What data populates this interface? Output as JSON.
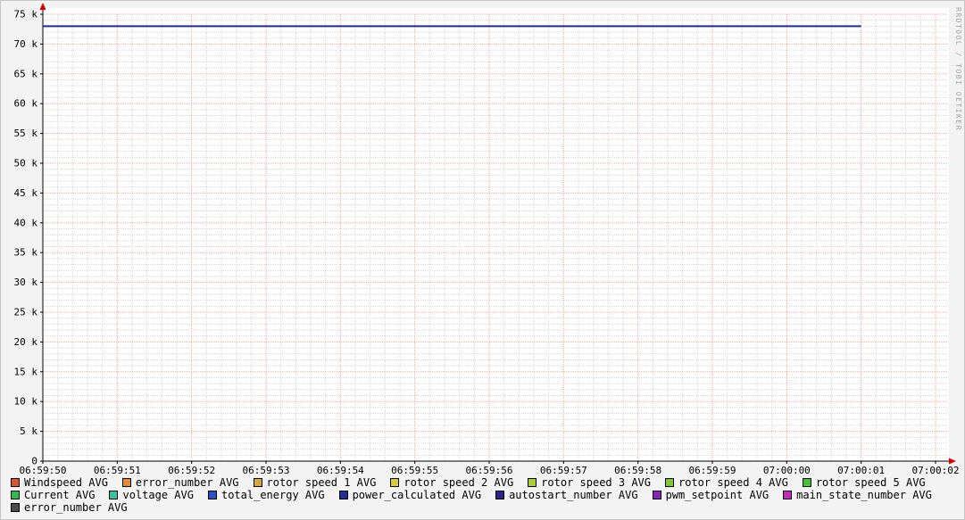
{
  "watermark": "RRDTOOL / TOBI OETIKER",
  "chart_data": {
    "type": "line",
    "title": "",
    "xlim": [
      0,
      12
    ],
    "ylim": [
      0,
      75000
    ],
    "x_major_step": 1,
    "x_minor_step": 0.2,
    "y_major_step": 5000,
    "y_minor_step": 1000,
    "x_ticks": [
      {
        "x": 0,
        "label": "06:59:50"
      },
      {
        "x": 1,
        "label": "06:59:51"
      },
      {
        "x": 2,
        "label": "06:59:52"
      },
      {
        "x": 3,
        "label": "06:59:53"
      },
      {
        "x": 4,
        "label": "06:59:54"
      },
      {
        "x": 5,
        "label": "06:59:55"
      },
      {
        "x": 6,
        "label": "06:59:56"
      },
      {
        "x": 7,
        "label": "06:59:57"
      },
      {
        "x": 8,
        "label": "06:59:58"
      },
      {
        "x": 9,
        "label": "06:59:59"
      },
      {
        "x": 10,
        "label": "07:00:00"
      },
      {
        "x": 11,
        "label": "07:00:01"
      },
      {
        "x": 12,
        "label": "07:00:02"
      }
    ],
    "y_ticks": [
      {
        "value": 0,
        "label": "0"
      },
      {
        "value": 5000,
        "label": "5 k"
      },
      {
        "value": 10000,
        "label": "10 k"
      },
      {
        "value": 15000,
        "label": "15 k"
      },
      {
        "value": 20000,
        "label": "20 k"
      },
      {
        "value": 25000,
        "label": "25 k"
      },
      {
        "value": 30000,
        "label": "30 k"
      },
      {
        "value": 35000,
        "label": "35 k"
      },
      {
        "value": 40000,
        "label": "40 k"
      },
      {
        "value": 45000,
        "label": "45 k"
      },
      {
        "value": 50000,
        "label": "50 k"
      },
      {
        "value": 55000,
        "label": "55 k"
      },
      {
        "value": 60000,
        "label": "60 k"
      },
      {
        "value": 65000,
        "label": "65 k"
      },
      {
        "value": 70000,
        "label": "70 k"
      },
      {
        "value": 75000,
        "label": "75 k"
      }
    ],
    "series": [
      {
        "name": "power_calculated AVG",
        "color": "#1b2e9b",
        "points": [
          [
            0,
            73000
          ],
          [
            11,
            73000
          ]
        ]
      }
    ],
    "grid": {
      "background": "#ffffff",
      "major_color": "#f2aba4",
      "minor_color": "#d9d9d9"
    },
    "axes": {
      "color": "#000000",
      "arrow_color": "#dd0000"
    },
    "legend_position": "bottom"
  },
  "legend": {
    "rows": [
      [
        {
          "label": "Windspeed AVG",
          "color": "#e0532f"
        },
        {
          "label": "error_number AVG",
          "color": "#e58a33"
        },
        {
          "label": "rotor speed 1 AVG",
          "color": "#d8a832"
        },
        {
          "label": "rotor speed 2 AVG",
          "color": "#d6ce34"
        },
        {
          "label": "rotor speed 3 AVG",
          "color": "#afcf30"
        },
        {
          "label": "rotor speed 4 AVG",
          "color": "#7fc832"
        },
        {
          "label": "rotor speed 5 AVG",
          "color": "#44c333"
        }
      ],
      [
        {
          "label": "Current AVG",
          "color": "#28be4c"
        },
        {
          "label": "voltage AVG",
          "color": "#2fc6a5"
        },
        {
          "label": "total_energy AVG",
          "color": "#2b50c8"
        },
        {
          "label": "power_calculated AVG",
          "color": "#1b2e9b"
        },
        {
          "label": "autostart_number AVG",
          "color": "#2b2386"
        },
        {
          "label": "pwm_setpoint AVG",
          "color": "#8826bc"
        },
        {
          "label": "main_state_number AVG",
          "color": "#c32bc3"
        }
      ],
      [
        {
          "label": "error_number AVG",
          "color": "#4d4d4d"
        }
      ]
    ]
  }
}
